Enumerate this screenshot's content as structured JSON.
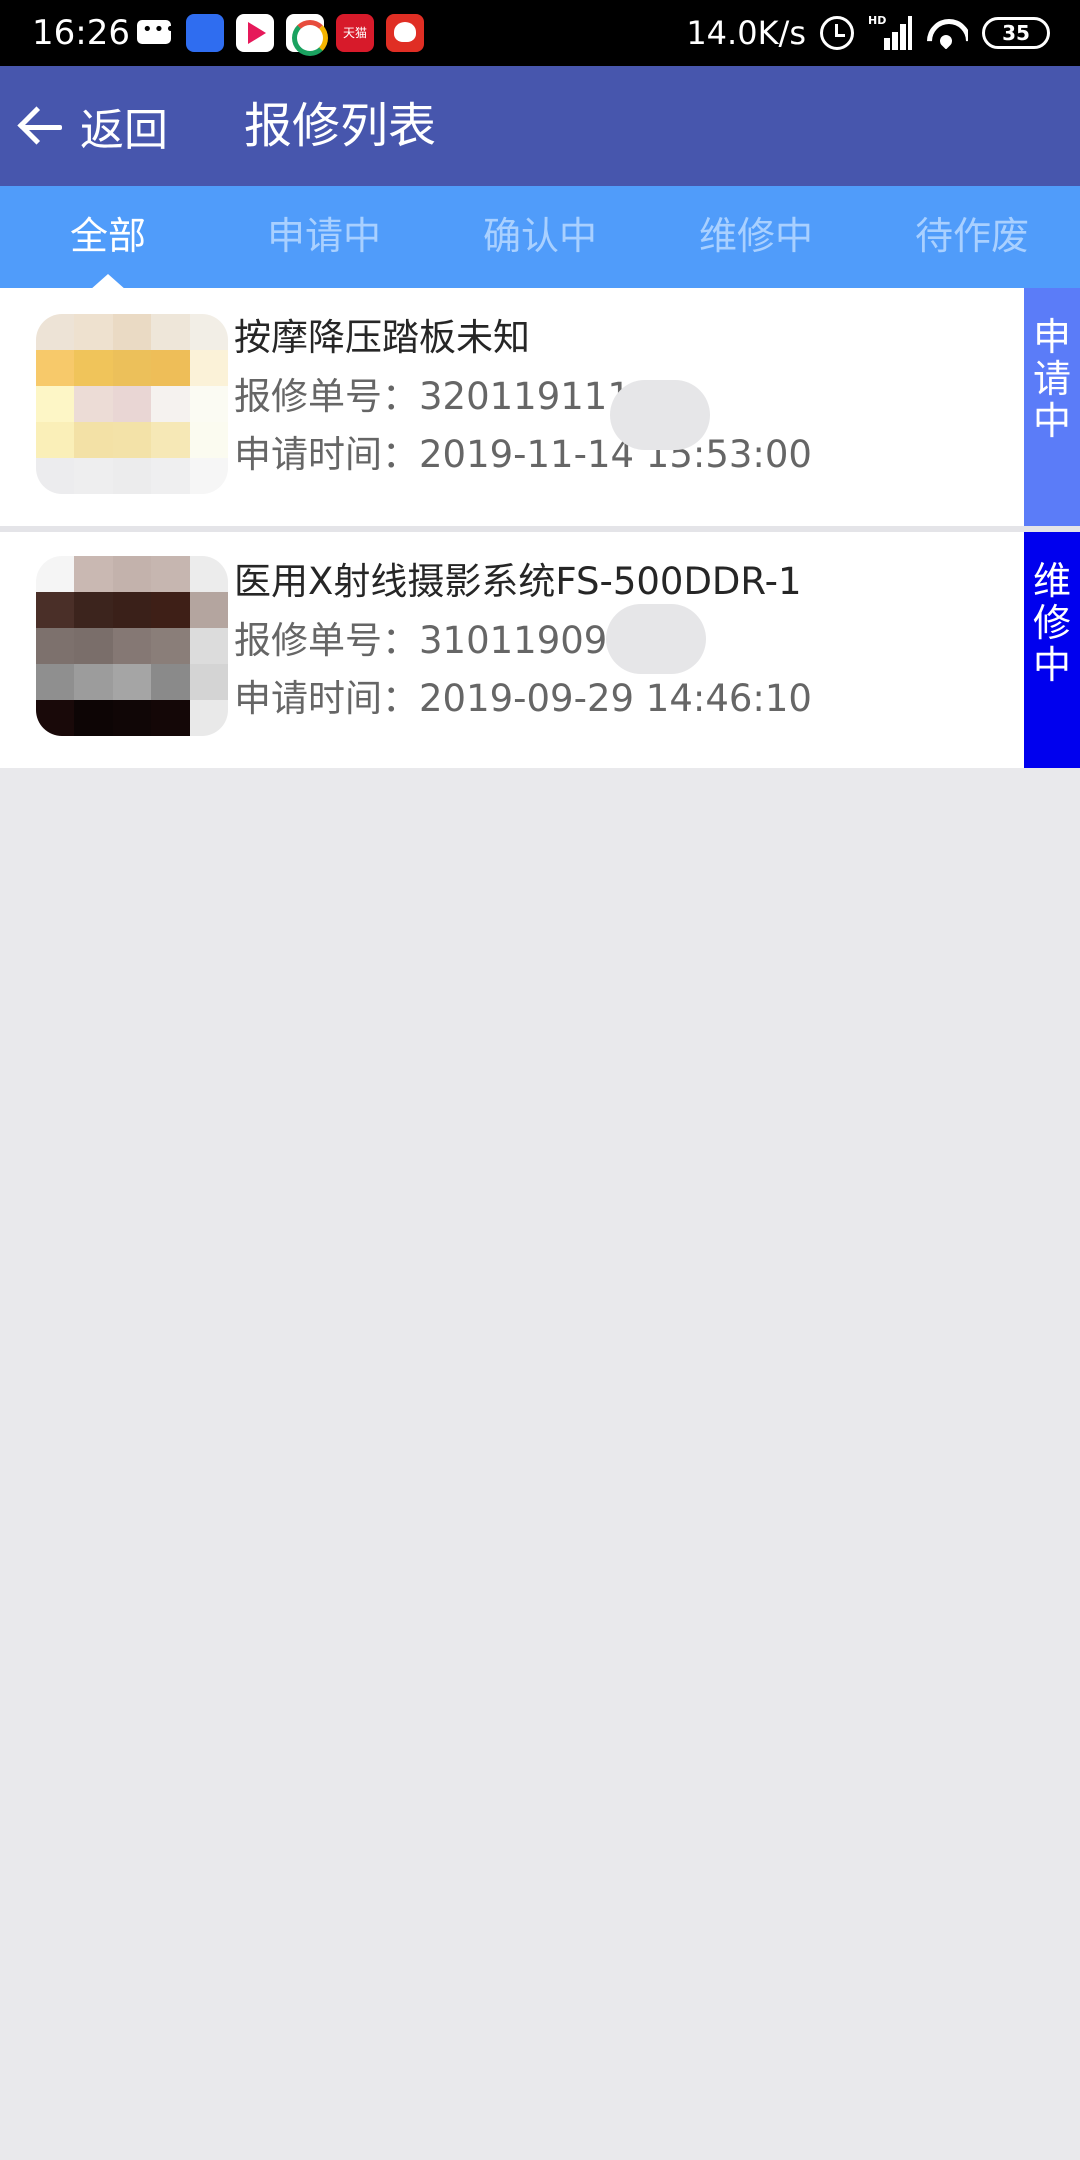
{
  "status_bar": {
    "time": "16:26",
    "network_speed": "14.0K/s",
    "network_type": "HD",
    "battery": "35",
    "tmall_label": "天猫",
    "icons": [
      "message-icon",
      "baidu-icon",
      "video-icon",
      "browser-icon",
      "tmall-icon",
      "pinduoduo-icon",
      "alarm-icon",
      "signal-icon",
      "wifi-icon",
      "battery-icon"
    ]
  },
  "header": {
    "back_label": "返回",
    "title": "报修列表"
  },
  "tabs": [
    {
      "label": "全部",
      "active": true
    },
    {
      "label": "申请中",
      "active": false
    },
    {
      "label": "确认中",
      "active": false
    },
    {
      "label": "维修中",
      "active": false
    },
    {
      "label": "待作废",
      "active": false
    }
  ],
  "items": [
    {
      "name": "按摩降压踏板未知",
      "order_label": "报修单号：",
      "order_no": "3201191111",
      "time_label": "申请时间：",
      "time": "2019-11-14 15:53:00",
      "status": [
        "申",
        "请",
        "中"
      ],
      "status_color": "#5b7cf8"
    },
    {
      "name": "医用X射线摄影系统FS-500DDR-1",
      "order_label": "报修单号：",
      "order_no": "3101190929",
      "time_label": "申请时间：",
      "time": "2019-09-29 14:46:10",
      "status": [
        "维",
        "修",
        "中"
      ],
      "status_color": "#0000ee"
    }
  ],
  "colors": {
    "header_bg": "#4756ad",
    "tab_bg": "#509cfa",
    "tab_inactive_text": "#a9d0ff",
    "page_bg": "#e9e9ec"
  }
}
